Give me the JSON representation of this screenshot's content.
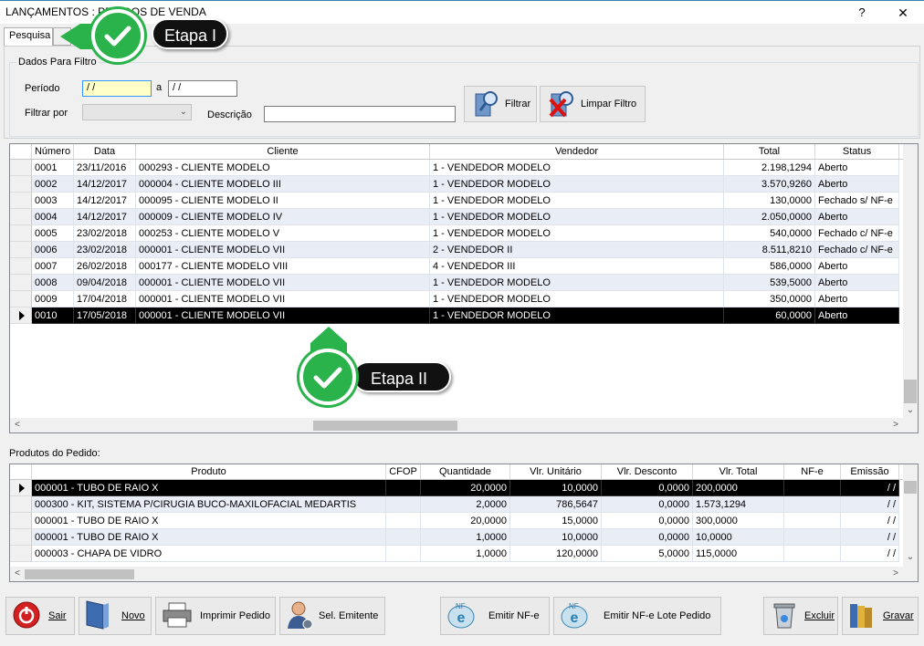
{
  "window": {
    "title": "LANÇAMENTOS : PEDIDOS DE VENDA",
    "help_label": "?",
    "close_label": "✕"
  },
  "tabs": [
    {
      "label": "Pesquisa"
    },
    {
      "label": ""
    }
  ],
  "filter": {
    "group_title": "Dados Para Filtro",
    "periodo_label": "Período",
    "date_from": " / /",
    "date_sep": "a",
    "date_to": " / /",
    "filtrar_por_label": "Filtrar por",
    "filtrar_por_value": "",
    "descricao_label": "Descrição",
    "descricao_value": "",
    "btn_filtrar": "Filtrar",
    "btn_limpar": "Limpar Filtro"
  },
  "orders": {
    "columns": [
      "Número",
      "Data",
      "Cliente",
      "Vendedor",
      "Total",
      "Status"
    ],
    "rows": [
      {
        "numero": "0001",
        "data": "23/11/2016",
        "cliente": "000293 - CLIENTE MODELO",
        "vendedor": "1 - VENDEDOR MODELO",
        "total": "2.198,1294",
        "status": "Aberto"
      },
      {
        "numero": "0002",
        "data": "14/12/2017",
        "cliente": "000004 - CLIENTE MODELO III",
        "vendedor": "1 - VENDEDOR MODELO",
        "total": "3.570,9260",
        "status": "Aberto"
      },
      {
        "numero": "0003",
        "data": "14/12/2017",
        "cliente": "000095 - CLIENTE MODELO II",
        "vendedor": "1 - VENDEDOR MODELO",
        "total": "130,0000",
        "status": "Fechado s/ NF-e"
      },
      {
        "numero": "0004",
        "data": "14/12/2017",
        "cliente": "000009 - CLIENTE MODELO IV",
        "vendedor": "1 - VENDEDOR MODELO",
        "total": "2.050,0000",
        "status": "Aberto"
      },
      {
        "numero": "0005",
        "data": "23/02/2018",
        "cliente": "000253 - CLIENTE MODELO V",
        "vendedor": "1 - VENDEDOR MODELO",
        "total": "540,0000",
        "status": "Fechado c/ NF-e"
      },
      {
        "numero": "0006",
        "data": "23/02/2018",
        "cliente": "000001 - CLIENTE MODELO VII",
        "vendedor": "2 - VENDEDOR II",
        "total": "8.511,8210",
        "status": "Fechado c/ NF-e"
      },
      {
        "numero": "0007",
        "data": "26/02/2018",
        "cliente": "000177 - CLIENTE MODELO VIII",
        "vendedor": "4 - VENDEDOR III",
        "total": "586,0000",
        "status": "Aberto"
      },
      {
        "numero": "0008",
        "data": "09/04/2018",
        "cliente": "000001 - CLIENTE MODELO VII",
        "vendedor": "1 - VENDEDOR MODELO",
        "total": "539,5000",
        "status": "Aberto"
      },
      {
        "numero": "0009",
        "data": "17/04/2018",
        "cliente": "000001 - CLIENTE MODELO VII",
        "vendedor": "1 - VENDEDOR MODELO",
        "total": "350,0000",
        "status": "Aberto"
      },
      {
        "numero": "0010",
        "data": "17/05/2018",
        "cliente": "000001 - CLIENTE MODELO VII",
        "vendedor": "1 - VENDEDOR MODELO",
        "total": "60,0000",
        "status": "Aberto"
      }
    ]
  },
  "products": {
    "label": "Produtos do Pedido:",
    "columns": [
      "Produto",
      "CFOP",
      "Quantidade",
      "Vlr. Unitário",
      "Vlr. Desconto",
      "Vlr. Total",
      "NF-e",
      "Emissão"
    ],
    "rows": [
      {
        "produto": "000001 - TUBO DE RAIO X",
        "cfop": "",
        "qtd": "20,0000",
        "unit": "10,0000",
        "desc": "0,0000",
        "total": "200,0000",
        "nfe": "",
        "emissao": " / /"
      },
      {
        "produto": "000300 - KIT, SISTEMA P/CIRUGIA BUCO-MAXILOFACIAL MEDARTIS",
        "cfop": "",
        "qtd": "2,0000",
        "unit": "786,5647",
        "desc": "0,0000",
        "total": "1.573,1294",
        "nfe": "",
        "emissao": " / /"
      },
      {
        "produto": "000001 - TUBO DE RAIO X",
        "cfop": "",
        "qtd": "20,0000",
        "unit": "15,0000",
        "desc": "0,0000",
        "total": "300,0000",
        "nfe": "",
        "emissao": " / /"
      },
      {
        "produto": "000001 - TUBO DE RAIO X",
        "cfop": "",
        "qtd": "1,0000",
        "unit": "10,0000",
        "desc": "0,0000",
        "total": "10,0000",
        "nfe": "",
        "emissao": " / /"
      },
      {
        "produto": "000003 - CHAPA DE VIDRO",
        "cfop": "",
        "qtd": "1,0000",
        "unit": "120,0000",
        "desc": "5,0000",
        "total": "115,0000",
        "nfe": "",
        "emissao": " / /"
      }
    ]
  },
  "actions": {
    "sair": "Sair",
    "novo": "Novo",
    "imprimir": "Imprimir Pedido",
    "sel_emitente": "Sel. Emitente",
    "emitir_nfe": "Emitir NF-e",
    "emitir_lote": "Emitir NF-e Lote Pedido",
    "excluir": "Excluir",
    "gravar": "Gravar"
  },
  "callouts": {
    "etapa1": "Etapa I",
    "etapa2": "Etapa II"
  },
  "colors": {
    "callout_green": "#29b34a",
    "selected_row": "#000000",
    "alt_row": "#e8edf6"
  }
}
